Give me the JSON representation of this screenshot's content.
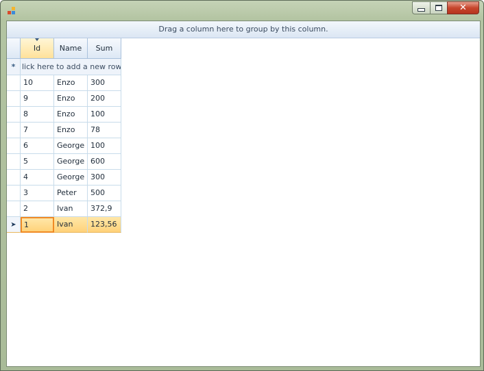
{
  "window": {
    "title": "",
    "icon": "app-form-icon",
    "buttons": {
      "minimize": "minimize-icon",
      "maximize": "maximize-icon",
      "close": "close-icon"
    }
  },
  "group_panel": {
    "text": "Drag a column here to group by this column."
  },
  "grid": {
    "columns": [
      "Id",
      "Name",
      "Sum"
    ],
    "sorted_column": "Id",
    "new_row_text": "lick here to add a new row",
    "new_row_glyph": "*",
    "current_glyph": "➤",
    "rows": [
      [
        "10",
        "Enzo",
        "300"
      ],
      [
        "9",
        "Enzo",
        "200"
      ],
      [
        "8",
        "Enzo",
        "100"
      ],
      [
        "7",
        "Enzo",
        "78"
      ],
      [
        "6",
        "George",
        "100"
      ],
      [
        "5",
        "George",
        "600"
      ],
      [
        "4",
        "George",
        "300"
      ],
      [
        "3",
        "Peter",
        "500"
      ],
      [
        "2",
        "Ivan",
        "372,9"
      ],
      [
        "1",
        "Ivan",
        "123,56"
      ]
    ],
    "current_row_index": 9
  },
  "colors": {
    "frame": "#b3c4a2",
    "selection": "#ffd27a",
    "current_cell_border": "#f08a24",
    "grid_lines": "#c7dbea"
  }
}
